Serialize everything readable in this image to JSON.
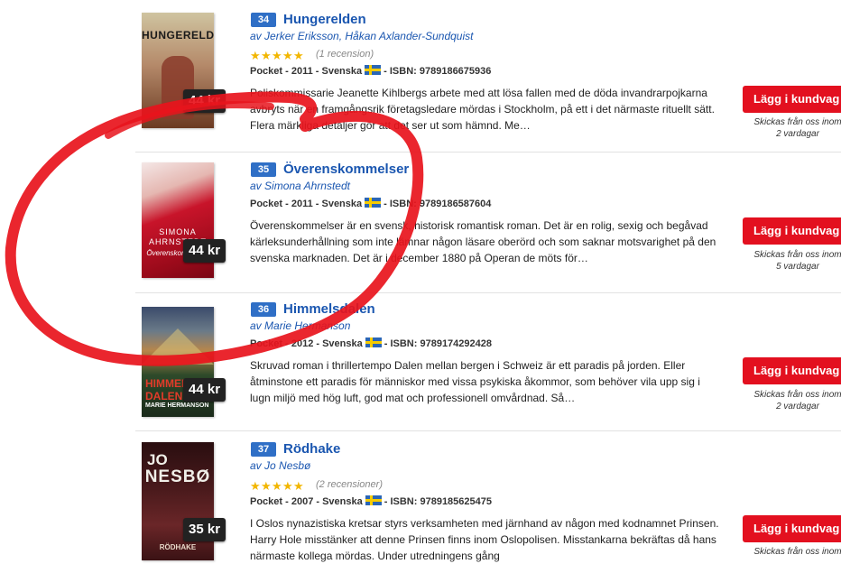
{
  "products": [
    {
      "rank": "34",
      "title": "Hungerelden",
      "author_prefix": "av",
      "author": "Jerker Eriksson, Håkan Axlander-Sundquist",
      "rating_stars": 5,
      "reviews": "(1 recension)",
      "meta_before_flag": "Pocket - 2011 - Svenska",
      "meta_after_flag": "- ISBN: 9789186675936",
      "description": "Poliskommissarie Jeanette Kihlbergs arbete med att lösa fallen med de döda invandrarpojkarna avbryts när en framgångsrik företagsledare mördas i Stockholm, på ett i det närmaste rituellt sätt. Flera märkliga detaljer gör att det ser ut som hämnd. Me…",
      "price": "44 kr",
      "cover_text": "HUNGERELDEN",
      "buy_label": "Lägg i kundvag",
      "ship_line1": "Skickas från oss inom",
      "ship_line2": "2 vardagar"
    },
    {
      "rank": "35",
      "title": "Överenskommelser",
      "author_prefix": "av",
      "author": "Simona Ahrnstedt",
      "meta_before_flag": "Pocket - 2011 - Svenska",
      "meta_after_flag": "- ISBN: 9789186587604",
      "description": "Överenskommelser är en svensk, historisk romantisk roman. Det är en rolig, sexig och begåvad kärleksunderhållning som inte lämnar någon läsare oberörd och som saknar motsvarighet på den svenska marknaden. Det är i december 1880 på Operan de möts för…",
      "price": "44 kr",
      "cover_text_1": "SIMONA",
      "cover_text_2": "AHRNSTEDT",
      "cover_text_3": "Överenskommelser",
      "buy_label": "Lägg i kundvag",
      "ship_line1": "Skickas från oss inom",
      "ship_line2": "5 vardagar"
    },
    {
      "rank": "36",
      "title": "Himmelsdalen",
      "author_prefix": "av",
      "author": "Marie Hermanson",
      "meta_before_flag": "Pocket - 2012 - Svenska",
      "meta_after_flag": "- ISBN: 9789174292428",
      "description": "Skruvad roman i thrillertempo Dalen mellan bergen i Schweiz är ett paradis på jorden. Eller åtminstone ett paradis för människor med vissa psykiska åkommor, som behöver vila upp sig i lugn miljö med hög luft, god mat och professionell omvårdnad. Så…",
      "price": "44 kr",
      "cover_text_1": "HIMMELS",
      "cover_text_2": "DALEN",
      "cover_text_3": "MARIE HERMANSON",
      "buy_label": "Lägg i kundvag",
      "ship_line1": "Skickas från oss inom",
      "ship_line2": "2 vardagar"
    },
    {
      "rank": "37",
      "title": "Rödhake",
      "author_prefix": "av",
      "author": "Jo Nesbø",
      "rating_stars": 5,
      "reviews": "(2 recensioner)",
      "meta_before_flag": "Pocket - 2007 - Svenska",
      "meta_after_flag": "- ISBN: 9789185625475",
      "description": "I Oslos nynazistiska kretsar styrs verksamheten med järnhand av någon med kodnamnet Prinsen. Harry Hole misstänker att denne Prinsen finns inom Oslopolisen. Misstankarna bekräftas då hans närmaste kollega mördas. Under utredningens gång",
      "price": "35 kr",
      "cover_text_1": "JO",
      "cover_text_2": "NESBØ",
      "cover_text_3": "RÖDHAKE",
      "buy_label": "Lägg i kundvag",
      "ship_line1": "Skickas från oss inom"
    }
  ],
  "colors": {
    "link": "#1a56b0",
    "rank_badge": "#2f6fc6",
    "buy_button": "#e3101f",
    "scribble": "#e8141c",
    "star": "#f2b600"
  }
}
